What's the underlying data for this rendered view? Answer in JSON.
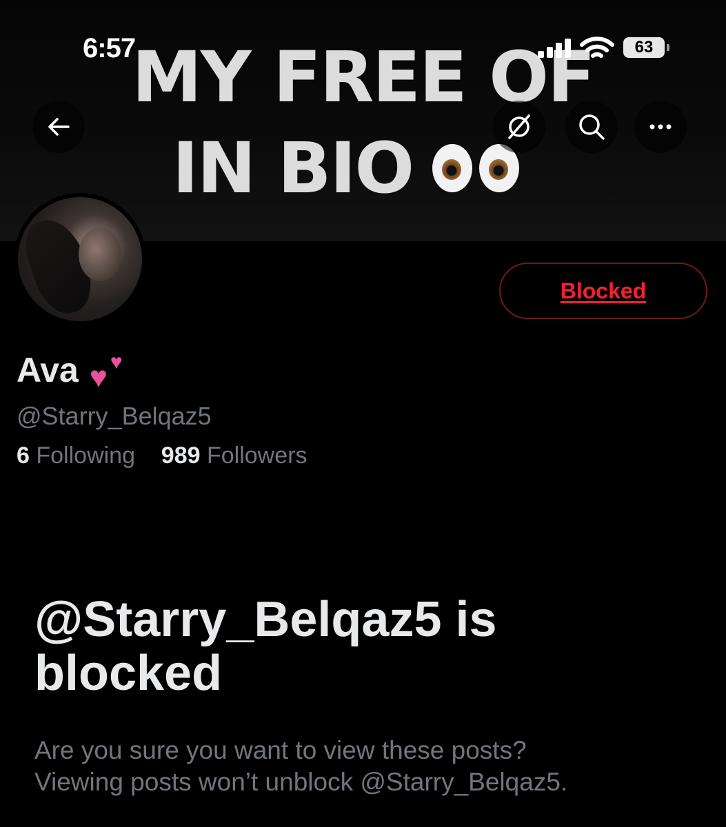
{
  "status_bar": {
    "time": "6:57",
    "battery": "63"
  },
  "banner": {
    "line1": "MY FREE OF",
    "line2": "IN BIO"
  },
  "header": {
    "back_icon": "arrow-left-icon",
    "grok_icon": "grok-icon",
    "search_icon": "search-icon",
    "more_icon": "more-horizontal-icon"
  },
  "profile": {
    "name": "Ava",
    "name_emoji": "two-hearts",
    "handle": "@Starry_Belqaz5",
    "following_count": "6",
    "following_label": "Following",
    "followers_count": "989",
    "followers_label": "Followers",
    "blocked_button": "Blocked"
  },
  "blocked_notice": {
    "title": "@Starry_Belqaz5 is blocked",
    "line1": "Are you sure you want to view these posts?",
    "line2": "Viewing posts won’t unblock @Starry_Belqaz5."
  },
  "colors": {
    "accent_red": "#f4212e",
    "muted": "#71767b",
    "text": "#e7e9ea",
    "heart_pink": "#e9529b"
  }
}
